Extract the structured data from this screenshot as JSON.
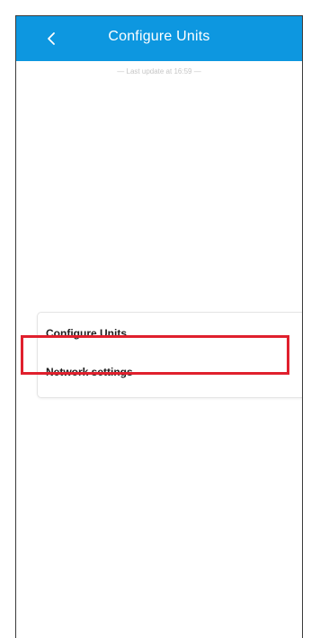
{
  "header": {
    "title": "Configure Units",
    "back_icon": "chevron-left-icon",
    "background_color": "#0d97e0"
  },
  "status": {
    "last_update": "— Last update at 16:59 —"
  },
  "menu": {
    "items": [
      {
        "label": "Configure Units"
      },
      {
        "label": "Network settings",
        "highlighted": true
      }
    ]
  },
  "highlight_color": "#e0202d"
}
